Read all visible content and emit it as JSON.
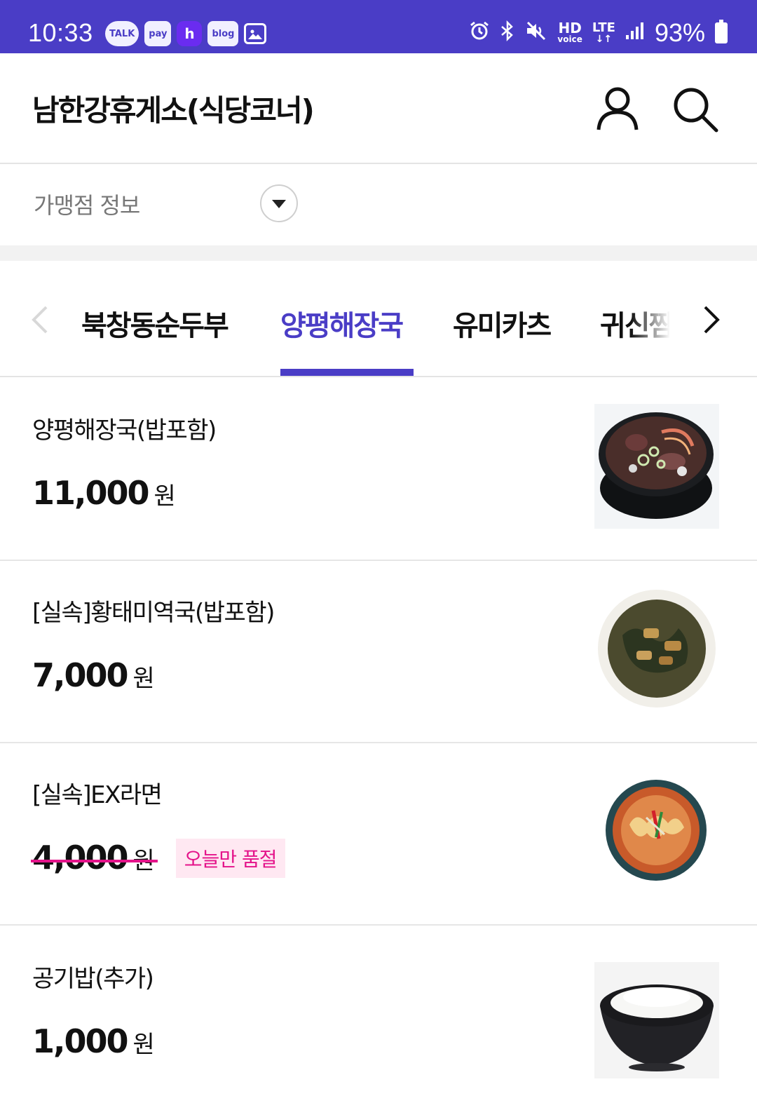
{
  "status_bar": {
    "time": "10:33",
    "notifications": [
      "TALK",
      "pay",
      "h",
      "blog"
    ],
    "network_label_top": "HD",
    "network_label_bottom": "voice",
    "lte_label": "LTE",
    "battery": "93%"
  },
  "header": {
    "title": "남한강휴게소(식당코너)",
    "icons": [
      "user-icon",
      "search-icon"
    ]
  },
  "store_info": {
    "label": "가맹점 정보"
  },
  "tabs": {
    "items": [
      "북창동순두부",
      "양평해장국",
      "유미카츠",
      "귀신짬"
    ],
    "active": "양평해장국"
  },
  "menu": {
    "items": [
      {
        "name": "양평해장국(밥포함)",
        "price": "11,000",
        "unit": "원",
        "sold_out": false
      },
      {
        "name": "[실속]황태미역국(밥포함)",
        "price": "7,000",
        "unit": "원",
        "sold_out": false
      },
      {
        "name": "[실속]EX라면",
        "price": "4,000",
        "unit": "원",
        "sold_out": true,
        "sold_out_label": "오늘만 품절"
      },
      {
        "name": "공기밥(추가)",
        "price": "1,000",
        "unit": "원",
        "sold_out": false
      }
    ]
  },
  "colors": {
    "brand": "#4a3dc6",
    "sold_out": "#e4138a"
  }
}
